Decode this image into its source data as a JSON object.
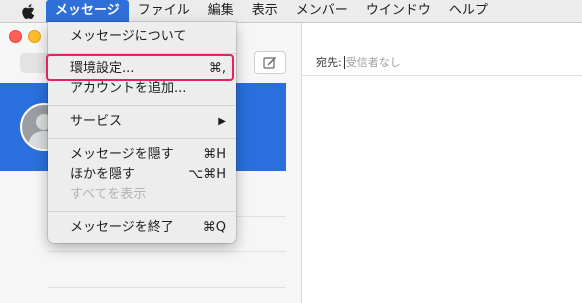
{
  "menubar": {
    "apple_icon": "apple-icon",
    "items": [
      "メッセージ",
      "ファイル",
      "編集",
      "表示",
      "メンバー",
      "ウインドウ",
      "ヘルプ"
    ],
    "active_index": 0,
    "active_color": "#2f6fd9"
  },
  "app_menu": {
    "items": [
      {
        "label": "メッセージについて",
        "shortcut": "",
        "enabled": true
      },
      {
        "label": "環境設定...",
        "shortcut": "⌘,",
        "enabled": true,
        "highlighted": true
      },
      {
        "label": "アカウントを追加...",
        "shortcut": "",
        "enabled": true
      },
      {
        "label": "サービス",
        "shortcut": "▶",
        "enabled": true
      },
      {
        "label": "メッセージを隠す",
        "shortcut": "⌘H",
        "enabled": true
      },
      {
        "label": "ほかを隠す",
        "shortcut": "⌥⌘H",
        "enabled": true
      },
      {
        "label": "すべてを表示",
        "shortcut": "",
        "enabled": false
      },
      {
        "label": "メッセージを終了",
        "shortcut": "⌘Q",
        "enabled": true
      }
    ],
    "highlight_color": "#e0245e"
  },
  "sidebar": {
    "compose_icon": "compose-icon",
    "selected_color": "#2a6fdd"
  },
  "compose": {
    "to_label": "宛先:",
    "to_placeholder": "受信者なし"
  }
}
